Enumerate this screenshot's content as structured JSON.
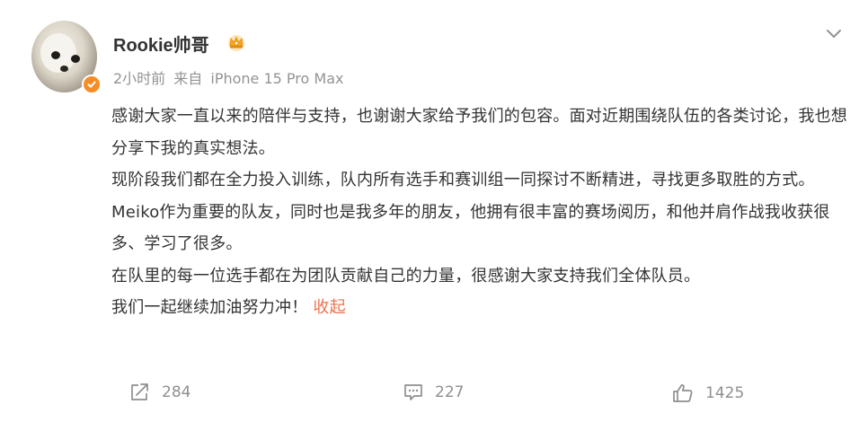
{
  "post": {
    "author": {
      "name": "Rookie帅哥"
    },
    "meta": {
      "time": "2小时前",
      "source_prefix": "来自",
      "source": "iPhone 15 Pro Max"
    },
    "paragraphs": [
      "感谢大家一直以来的陪伴与支持，也谢谢大家给予我们的包容。面对近期围绕队伍的各类讨论，我也想分享下我的真实想法。",
      "现阶段我们都在全力投入训练，队内所有选手和赛训组一同探讨不断精进，寻找更多取胜的方式。",
      "Meiko作为重要的队友，同时也是我多年的朋友，他拥有很丰富的赛场阅历，和他并肩作战我收获很多、学习了很多。",
      "在队里的每一位选手都在为团队贡献自己的力量，很感谢大家支持我们全体队员。"
    ],
    "last_line": "我们一起继续加油努力冲！",
    "collapse_label": "收起"
  },
  "actions": {
    "share_count": "284",
    "comment_count": "227",
    "like_count": "1425"
  },
  "colors": {
    "text": "#333333",
    "meta": "#939393",
    "link": "#eb7350",
    "verified": "#f78c24",
    "icon": "#8f8f8f"
  },
  "icons": {
    "verified": "verified-badge-icon",
    "crown": "crown-icon",
    "menu": "chevron-down-icon",
    "share": "share-icon",
    "comment": "comment-icon",
    "like": "thumbs-up-icon"
  }
}
